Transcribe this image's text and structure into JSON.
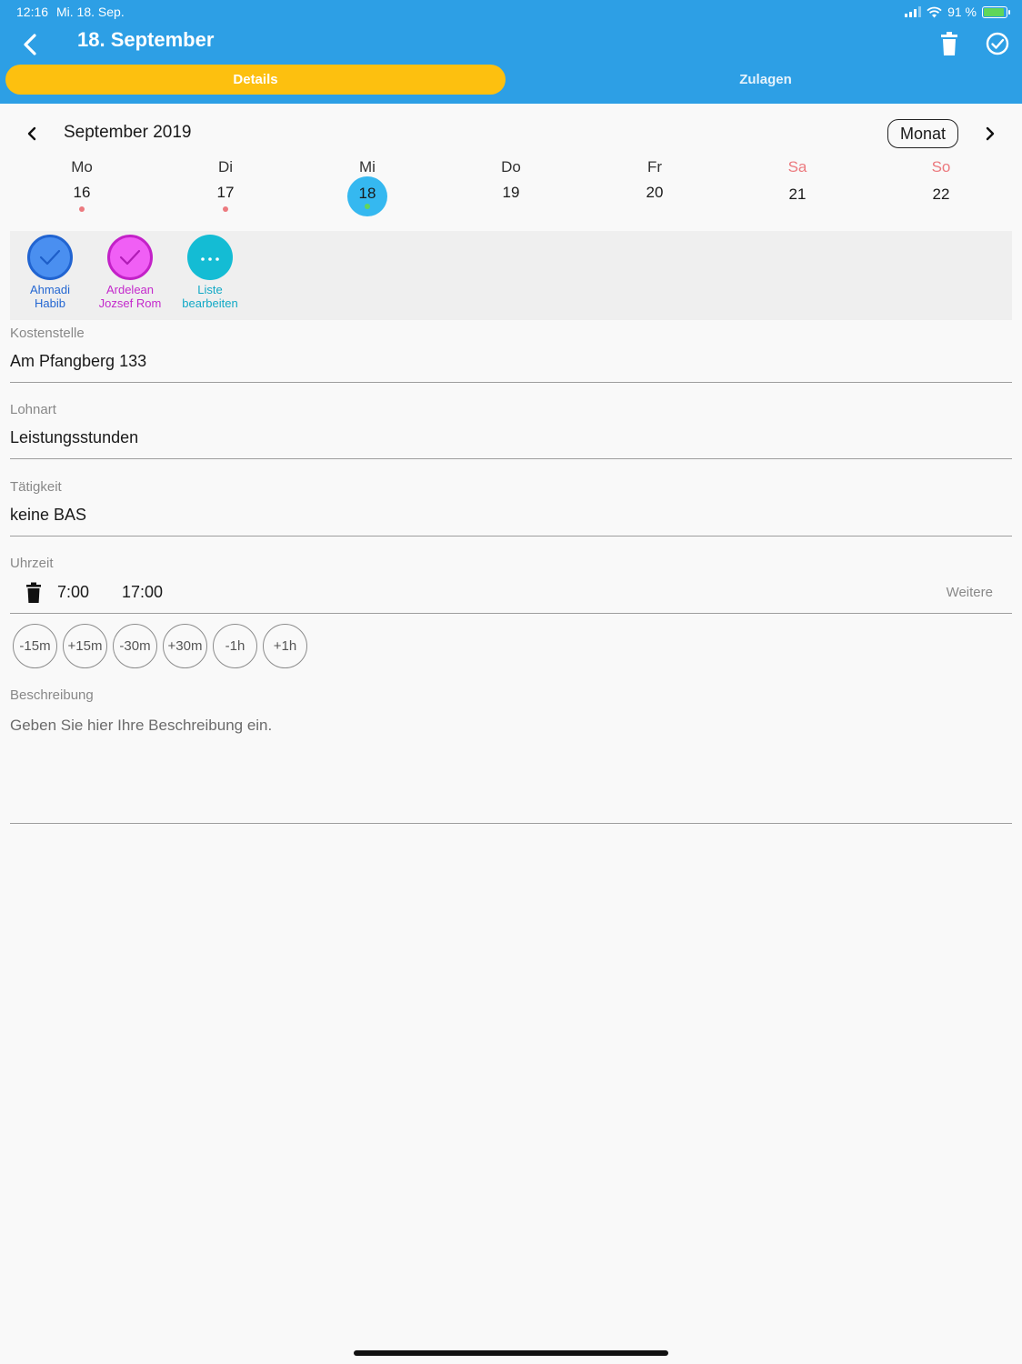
{
  "status_bar": {
    "time": "12:16",
    "date": "Mi. 18. Sep.",
    "battery": "91 %"
  },
  "header": {
    "title": "18. September",
    "icons": {
      "back": "back-icon",
      "trash": "trash-icon",
      "confirm": "check-circle-icon"
    }
  },
  "tabs": [
    {
      "label": "Details",
      "active": true
    },
    {
      "label": "Zulagen",
      "active": false
    }
  ],
  "calendar": {
    "month_label": "September 2019",
    "view_button": "Monat",
    "days": [
      {
        "name": "Mo",
        "num": "16",
        "dot": true
      },
      {
        "name": "Di",
        "num": "17",
        "dot": true
      },
      {
        "name": "Mi",
        "num": "18",
        "dot": true,
        "selected": true
      },
      {
        "name": "Do",
        "num": "19",
        "dot": false
      },
      {
        "name": "Fr",
        "num": "20",
        "dot": false
      },
      {
        "name": "Sa",
        "num": "21",
        "dot": false,
        "weekend": true
      },
      {
        "name": "So",
        "num": "22",
        "dot": false,
        "weekend": true
      }
    ]
  },
  "people": [
    {
      "line1": "Ahmadi",
      "line2": "Habib",
      "color": "#4a8ff0"
    },
    {
      "line1": "Ardelean",
      "line2": "Jozsef Rom",
      "color": "#f05ff5"
    },
    {
      "line1": "Liste",
      "line2": "bearbeiten",
      "color": "#14bcd4"
    }
  ],
  "fields": {
    "kostenstelle": {
      "label": "Kostenstelle",
      "value": "Am Pfangberg 133"
    },
    "lohnart": {
      "label": "Lohnart",
      "value": "Leistungsstunden"
    },
    "taetigkeit": {
      "label": "Tätigkeit",
      "value": "keine BAS"
    }
  },
  "uhrzeit": {
    "label": "Uhrzeit",
    "start": "7:00",
    "end": "17:00",
    "more": "Weitere"
  },
  "adjust_buttons": [
    "-15m",
    "+15m",
    "-30m",
    "+30m",
    "-1h",
    "+1h"
  ],
  "beschreibung": {
    "label": "Beschreibung",
    "placeholder": "Geben Sie hier Ihre Beschreibung ein."
  },
  "colors": {
    "header": "#2d9fe5",
    "active_tab": "#fdc00f",
    "selected_day": "#35b8f0"
  }
}
